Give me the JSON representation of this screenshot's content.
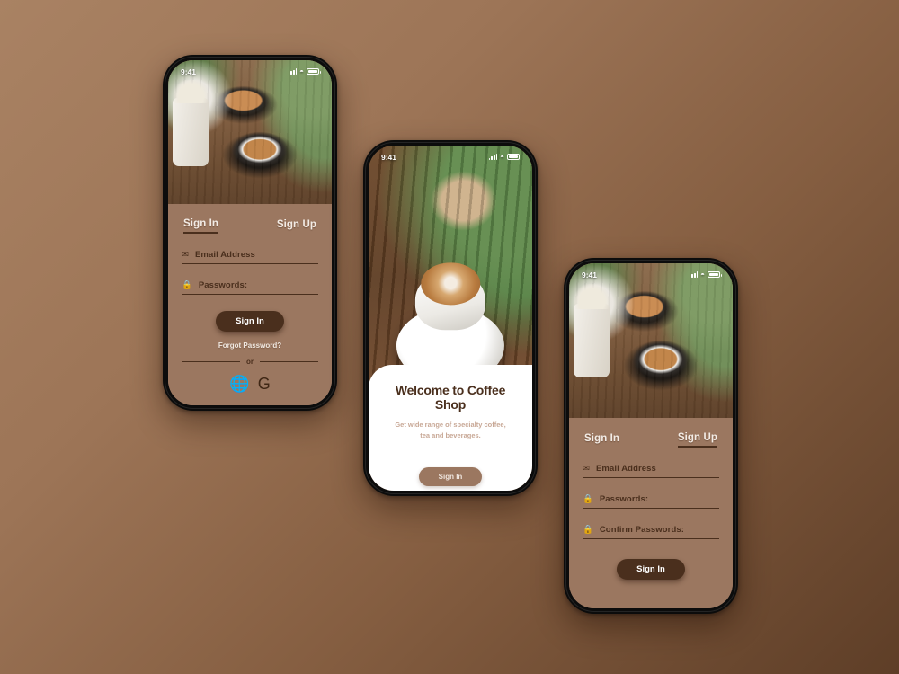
{
  "background": {
    "from": "#a98263",
    "to": "#5e3e27"
  },
  "theme": {
    "panel": "#9b7760",
    "dark": "#4a2f1d",
    "card": "#ffffff",
    "muted_text": "#c8a896"
  },
  "status_bar": {
    "time": "9:41",
    "signal_icon": "signal-icon",
    "wifi_icon": "wifi-icon",
    "battery_icon": "battery-icon"
  },
  "phones": [
    {
      "id": "signin",
      "image_alt": "two-cappuccinos-photo",
      "tabs": [
        {
          "label": "Sign In",
          "active": true
        },
        {
          "label": "Sign Up",
          "active": false
        }
      ],
      "fields": [
        {
          "icon": "envelope-icon",
          "glyph": "✉",
          "label": "Email Address"
        },
        {
          "icon": "lock-icon",
          "glyph": "🔒",
          "label": "Passwords:"
        }
      ],
      "submit_label": "Sign In",
      "forgot_label": "Forgot Password?",
      "or_label": "or",
      "socials": [
        {
          "name": "facebook-icon",
          "glyph": "🅵"
        },
        {
          "name": "google-icon",
          "glyph": "G"
        }
      ]
    },
    {
      "id": "welcome",
      "image_alt": "latte-with-coffee-beans-photo",
      "title": "Welcome to Coffee Shop",
      "subtitle_line1": "Get wide range of specialty coffee,",
      "subtitle_line2": "tea and beverages.",
      "submit_label": "Sign In"
    },
    {
      "id": "signup",
      "image_alt": "two-cappuccinos-photo",
      "tabs": [
        {
          "label": "Sign In",
          "active": false
        },
        {
          "label": "Sign Up",
          "active": true
        }
      ],
      "fields": [
        {
          "icon": "envelope-icon",
          "glyph": "✉",
          "label": "Email Address"
        },
        {
          "icon": "lock-icon",
          "glyph": "🔒",
          "label": "Passwords:"
        },
        {
          "icon": "lock-icon",
          "glyph": "🔒",
          "label": "Confirm Passwords:"
        }
      ],
      "submit_label": "Sign In"
    }
  ]
}
